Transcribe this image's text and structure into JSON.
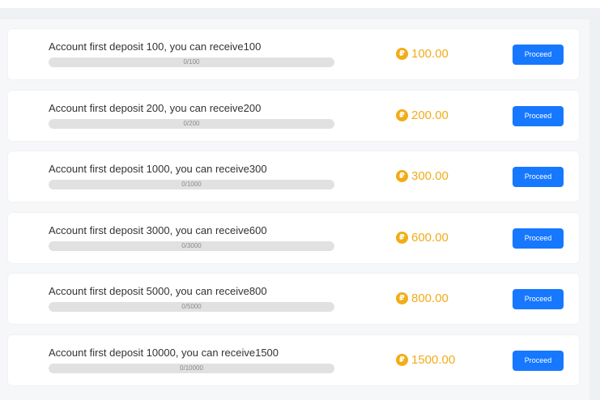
{
  "tasks": [
    {
      "title": "Account first deposit 100, you can receive100",
      "progress_text": "0/100",
      "progress": 0,
      "amount": "100.00",
      "button_label": "Proceed"
    },
    {
      "title": "Account first deposit 200, you can receive200",
      "progress_text": "0/200",
      "progress": 0,
      "amount": "200.00",
      "button_label": "Proceed"
    },
    {
      "title": "Account first deposit 1000, you can receive300",
      "progress_text": "0/1000",
      "progress": 0,
      "amount": "300.00",
      "button_label": "Proceed"
    },
    {
      "title": "Account first deposit 3000, you can receive600",
      "progress_text": "0/3000",
      "progress": 0,
      "amount": "600.00",
      "button_label": "Proceed"
    },
    {
      "title": "Account first deposit 5000, you can receive800",
      "progress_text": "0/5000",
      "progress": 0,
      "amount": "800.00",
      "button_label": "Proceed"
    },
    {
      "title": "Account first deposit 10000, you can receive1500",
      "progress_text": "0/10000",
      "progress": 0,
      "amount": "1500.00",
      "button_label": "Proceed"
    }
  ],
  "coin_symbol": "₽",
  "colors": {
    "accent": "#1677ff",
    "coin": "#f1ad16",
    "amount": "#f0ac1a",
    "track": "#e1e1e1"
  },
  "icons": {
    "coin": "coin-icon"
  }
}
